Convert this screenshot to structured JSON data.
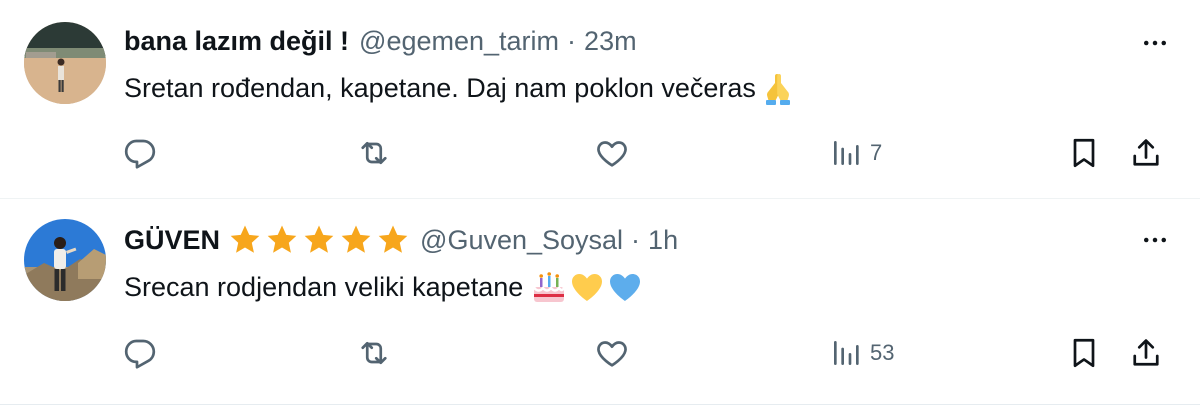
{
  "tweets": [
    {
      "name": "bana lazım değil !",
      "handle": "@egemen_tarim",
      "separator": "·",
      "time": "23m",
      "text": "Sretan rođendan, kapetane. Daj nam poklon večeras",
      "emojis": [
        "folded-hands"
      ],
      "views": "7",
      "badges": []
    },
    {
      "name": "GÜVEN",
      "handle": "@Guven_Soysal",
      "separator": "·",
      "time": "1h",
      "text": "Srecan rodjendan veliki kapetane",
      "emojis": [
        "birthday-cake",
        "yellow-heart",
        "blue-heart"
      ],
      "views": "53",
      "badges": [
        "star",
        "star",
        "star",
        "star",
        "star"
      ]
    }
  ],
  "colors": {
    "text": "#0f1419",
    "secondary": "#536471",
    "divider": "#eff3f4",
    "star": "#f7a61c"
  },
  "icons": [
    "more-icon",
    "reply-icon",
    "retweet-icon",
    "like-icon",
    "views-icon",
    "bookmark-icon",
    "share-icon"
  ]
}
